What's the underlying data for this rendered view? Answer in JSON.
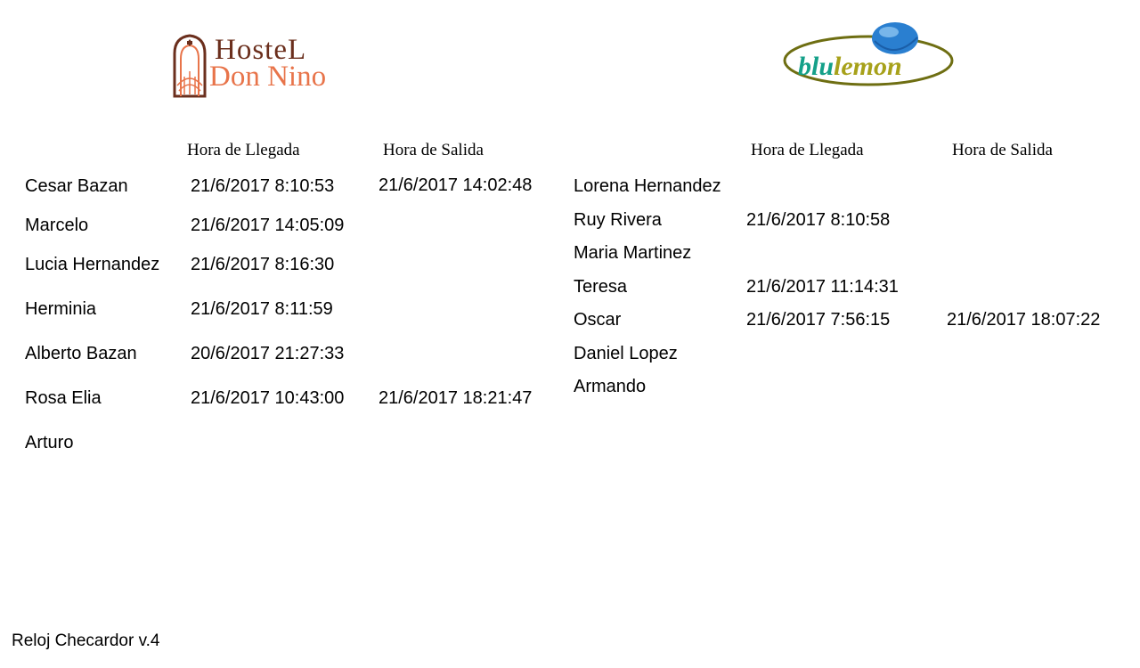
{
  "logos": {
    "hostel": {
      "line1": "HosteL",
      "line2": "Don Nino"
    },
    "blulemon": {
      "part1": "blu",
      "part2": "lemon"
    }
  },
  "left": {
    "headers": {
      "arrival": "Hora de Llegada",
      "departure": "Hora de Salida"
    },
    "rows": [
      {
        "name": "Cesar Bazan",
        "arrival": "21/6/2017 8:10:53",
        "departure": "21/6/2017 14:02:48"
      },
      {
        "name": "Marcelo",
        "arrival": "21/6/2017 14:05:09",
        "departure": ""
      },
      {
        "name": "Lucia Hernandez",
        "arrival": "21/6/2017 8:16:30",
        "departure": ""
      },
      {
        "name": "Herminia",
        "arrival": "21/6/2017 8:11:59",
        "departure": ""
      },
      {
        "name": "Alberto Bazan",
        "arrival": "20/6/2017 21:27:33",
        "departure": ""
      },
      {
        "name": "Rosa Elia",
        "arrival": "21/6/2017 10:43:00",
        "departure": "21/6/2017 18:21:47"
      },
      {
        "name": "Arturo",
        "arrival": "",
        "departure": ""
      }
    ]
  },
  "right": {
    "headers": {
      "arrival": "Hora de Llegada",
      "departure": "Hora de Salida"
    },
    "rows": [
      {
        "name": "Lorena Hernandez",
        "arrival": "",
        "departure": ""
      },
      {
        "name": "Ruy Rivera",
        "arrival": "21/6/2017 8:10:58",
        "departure": ""
      },
      {
        "name": "Maria Martinez",
        "arrival": "",
        "departure": ""
      },
      {
        "name": "Teresa",
        "arrival": "21/6/2017 11:14:31",
        "departure": ""
      },
      {
        "name": "Oscar",
        "arrival": "21/6/2017 7:56:15",
        "departure": "21/6/2017 18:07:22"
      },
      {
        "name": "Daniel Lopez",
        "arrival": "",
        "departure": ""
      },
      {
        "name": "Armando",
        "arrival": "",
        "departure": ""
      }
    ]
  },
  "footer": {
    "version": "Reloj Checardor v.4"
  }
}
